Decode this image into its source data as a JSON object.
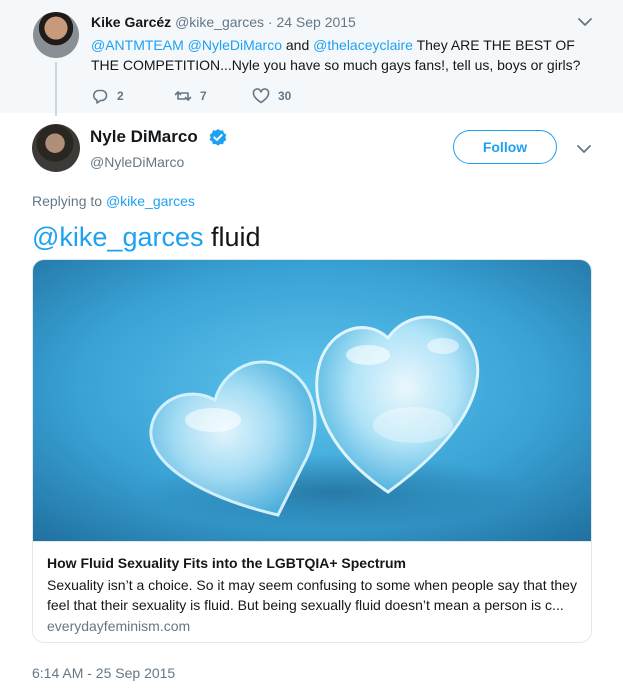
{
  "parent_tweet": {
    "author_name": "Kike Garcéz",
    "author_handle": "@kike_garces",
    "separator": "·",
    "date": "24 Sep 2015",
    "text_parts": {
      "mention1": "@ANTMTEAM",
      "mention2": "@NyleDiMarco",
      "and": " and ",
      "mention3": "@thelaceyclaire",
      "rest": " They ARE THE BEST OF THE COMPETITION...Nyle you have so much gays fans!, tell us, boys or girls?"
    },
    "replies": "2",
    "retweets": "7",
    "likes": "30"
  },
  "main_tweet": {
    "author_name": "Nyle DiMarco",
    "author_handle": "@NyleDiMarco",
    "follow_label": "Follow",
    "replying_prefix": "Replying to ",
    "replying_to": "@kike_garces",
    "text_mention": "@kike_garces",
    "text_body": " fluid",
    "timestamp": "6:14 AM - 25 Sep 2015"
  },
  "link_card": {
    "title": "How Fluid Sexuality Fits into the LGBTQIA+ Spectrum",
    "description": "Sexuality isn’t a choice. So it may seem confusing to some when people say that they feel that their sexuality is fluid. But being sexually fluid doesn’t mean a person is c...",
    "domain": "everydayfeminism.com"
  },
  "colors": {
    "accent": "#1da1f2",
    "muted": "#657786",
    "parent_bg": "#f5f8fa"
  },
  "icons": {
    "reply": "reply-icon",
    "retweet": "retweet-icon",
    "like": "heart-icon",
    "verified": "verified-badge-icon",
    "more": "chevron-down-icon"
  }
}
